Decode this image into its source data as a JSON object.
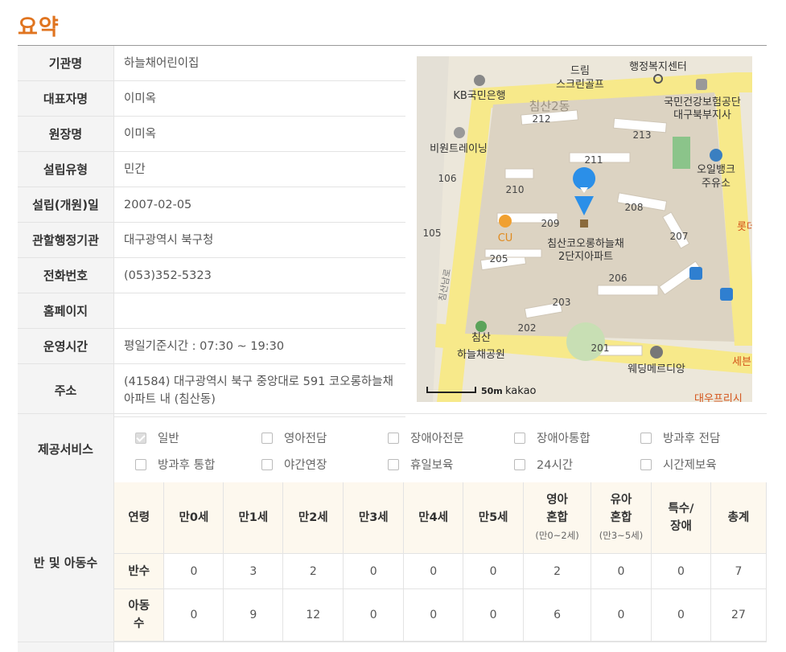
{
  "page": {
    "title": "요약"
  },
  "info": [
    {
      "label": "기관명",
      "value": "하늘채어린이집"
    },
    {
      "label": "대표자명",
      "value": "이미옥"
    },
    {
      "label": "원장명",
      "value": "이미옥"
    },
    {
      "label": "설립유형",
      "value": "민간"
    },
    {
      "label": "설립(개원)일",
      "value": "2007-02-05"
    },
    {
      "label": "관할행정기관",
      "value": "대구광역시 북구청"
    },
    {
      "label": "전화번호",
      "value": "(053)352-5323"
    },
    {
      "label": "홈페이지",
      "value": ""
    },
    {
      "label": "운영시간",
      "value": "평일기준시간 : 07:30 ~ 19:30"
    },
    {
      "label": "주소",
      "value": "(41584) 대구광역시 북구 중앙대로 591 코오롱하늘채아파트 내 (침산동)"
    }
  ],
  "map": {
    "labels": {
      "dream": "드림",
      "screen_golf": "스크린골프",
      "welfare": "행정복지센터",
      "kb": "KB국민은행",
      "district": "침산2동",
      "nhis1": "국민건강보험공단",
      "nhis2": "대구북부지사",
      "biwon": "비원트레이닝",
      "oil1": "오일뱅크",
      "oil2": "주유소",
      "lotte": "롯데하",
      "cu": "CU",
      "apt1": "침산코오롱하늘채",
      "apt2": "2단지아파트",
      "road": "침산남로",
      "park1": "침산",
      "park2": "하늘채공원",
      "wedding": "웨딩메르디앙",
      "sebon": "세븐",
      "daewoo": "대우프리시",
      "scale": "50m",
      "brand": "kakao"
    },
    "buildings": [
      "212",
      "213",
      "211",
      "106",
      "210",
      "208",
      "209",
      "105",
      "207",
      "205",
      "206",
      "203",
      "202",
      "201"
    ]
  },
  "services": {
    "label": "제공서비스",
    "items": [
      {
        "name": "일반",
        "checked": true
      },
      {
        "name": "영아전담",
        "checked": false
      },
      {
        "name": "장애아전문",
        "checked": false
      },
      {
        "name": "장애아통합",
        "checked": false
      },
      {
        "name": "방과후 전담",
        "checked": false
      },
      {
        "name": "방과후 통합",
        "checked": false
      },
      {
        "name": "야간연장",
        "checked": false
      },
      {
        "name": "휴일보육",
        "checked": false
      },
      {
        "name": "24시간",
        "checked": false
      },
      {
        "name": "시간제보육",
        "checked": false
      }
    ]
  },
  "classes": {
    "label": "반 및 아동수",
    "headers": [
      {
        "main": "연령"
      },
      {
        "main": "만0세"
      },
      {
        "main": "만1세"
      },
      {
        "main": "만2세"
      },
      {
        "main": "만3세"
      },
      {
        "main": "만4세"
      },
      {
        "main": "만5세"
      },
      {
        "main": "영아\n혼합",
        "sub": "(만0~2세)"
      },
      {
        "main": "유아\n혼합",
        "sub": "(만3~5세)"
      },
      {
        "main": "특수/\n장애"
      },
      {
        "main": "총계"
      }
    ],
    "rows": [
      {
        "label": "반수",
        "values": [
          "0",
          "3",
          "2",
          "0",
          "0",
          "0",
          "2",
          "0",
          "0",
          "7"
        ]
      },
      {
        "label": "아동\n수",
        "values": [
          "0",
          "9",
          "12",
          "0",
          "0",
          "0",
          "6",
          "0",
          "0",
          "27"
        ]
      }
    ]
  }
}
